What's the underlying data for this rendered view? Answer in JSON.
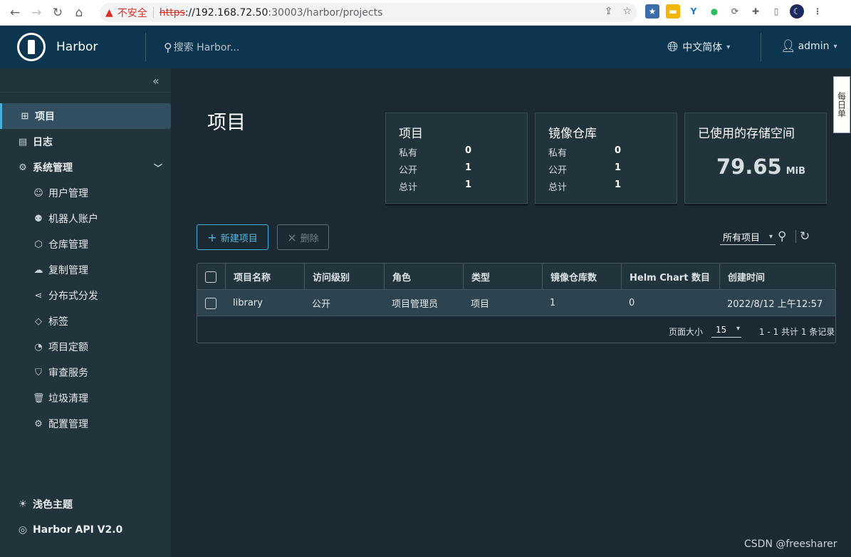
{
  "browser": {
    "insecure_label": "不安全",
    "url_scheme": "https",
    "url_host": "://192.168.72.50",
    "url_rest": ":30003/harbor/projects"
  },
  "header": {
    "brand": "Harbor",
    "search_placeholder": "搜索 Harbor...",
    "language": "中文简体",
    "user": "admin"
  },
  "sidebar": {
    "items": [
      {
        "label": "项目",
        "icon": "projects-icon"
      },
      {
        "label": "日志",
        "icon": "logs-icon"
      },
      {
        "label": "系统管理",
        "icon": "admin-icon"
      }
    ],
    "sub_items": [
      {
        "label": "用户管理",
        "icon": "users-icon"
      },
      {
        "label": "机器人账户",
        "icon": "robot-icon"
      },
      {
        "label": "仓库管理",
        "icon": "registry-icon"
      },
      {
        "label": "复制管理",
        "icon": "replication-icon"
      },
      {
        "label": "分布式分发",
        "icon": "distribution-icon"
      },
      {
        "label": "标签",
        "icon": "tag-icon"
      },
      {
        "label": "项目定额",
        "icon": "quota-icon"
      },
      {
        "label": "审查服务",
        "icon": "shield-icon"
      },
      {
        "label": "垃圾清理",
        "icon": "trash-icon"
      },
      {
        "label": "配置管理",
        "icon": "gear-icon"
      }
    ],
    "theme_label": "浅色主题",
    "api_label": "Harbor API V2.0"
  },
  "main": {
    "title": "项目",
    "cards": {
      "projects": {
        "title": "项目",
        "private_label": "私有",
        "private": "0",
        "public_label": "公开",
        "public": "1",
        "total_label": "总计",
        "total": "1"
      },
      "repos": {
        "title": "镜像仓库",
        "private_label": "私有",
        "private": "0",
        "public_label": "公开",
        "public": "1",
        "total_label": "总计",
        "total": "1"
      },
      "storage": {
        "title": "已使用的存储空间",
        "value": "79.65",
        "unit": "MiB"
      }
    },
    "new_project_label": "新建项目",
    "delete_label": "删除",
    "filter_value": "所有项目"
  },
  "table": {
    "headers": [
      "项目名称",
      "访问级别",
      "角色",
      "类型",
      "镜像仓库数",
      "Helm Chart 数目",
      "创建时间"
    ],
    "rows": [
      {
        "name": "library",
        "access": "公开",
        "role": "项目管理员",
        "type": "项目",
        "repos": "1",
        "charts": "0",
        "created": "2022/8/12 上午12:57"
      }
    ],
    "page_size_label": "页面大小",
    "page_size": "15",
    "pager_text": "1 - 1 共计 1 条记录"
  },
  "side_tab": "每日单",
  "watermark": "CSDN @freesharer"
}
